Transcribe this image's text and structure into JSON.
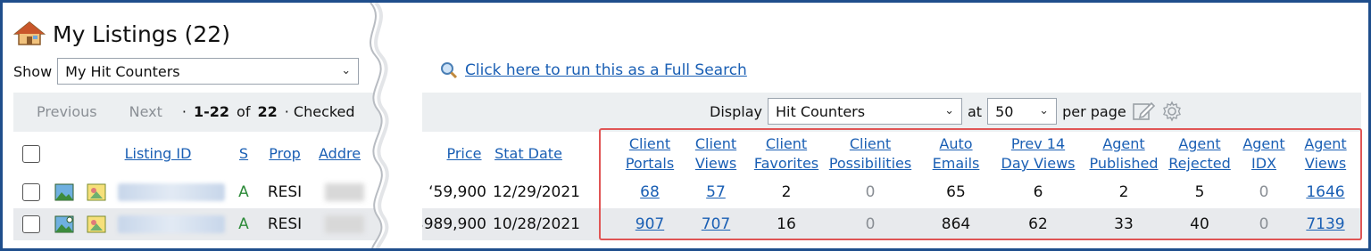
{
  "page": {
    "title": "My Listings (22)",
    "show_label": "Show",
    "show_value": "My Hit Counters",
    "full_search_link": "Click here to run this as a Full Search"
  },
  "toolbar": {
    "previous": "Previous",
    "next": "Next",
    "range_prefix": "·",
    "range": "1-22",
    "of": "of",
    "total": "22",
    "checked": "· Checked",
    "display_label": "Display",
    "display_value": "Hit Counters",
    "at_label": "at",
    "per_page_value": "50",
    "per_page_label": "per page"
  },
  "columns": {
    "listing_id": "Listing ID",
    "s": "S",
    "prop": "Prop",
    "address": "Addre",
    "price": "Price",
    "stat_date": "Stat Date",
    "client_portals": [
      "Client",
      "Portals"
    ],
    "client_views": [
      "Client",
      "Views"
    ],
    "client_favorites": [
      "Client",
      "Favorites"
    ],
    "client_possibilities": [
      "Client",
      "Possibilities"
    ],
    "auto_emails": [
      "Auto",
      "Emails"
    ],
    "prev_14": [
      "Prev 14",
      "Day Views"
    ],
    "agent_published": [
      "Agent",
      "Published"
    ],
    "agent_rejected": [
      "Agent",
      "Rejected"
    ],
    "agent_idx": [
      "Agent",
      "IDX"
    ],
    "agent_views": [
      "Agent",
      "Views"
    ]
  },
  "rows": [
    {
      "status": "A",
      "prop": "RESI",
      "price": "ʻ59,900",
      "stat_date": "12/29/2021",
      "client_portals": "68",
      "client_views": "57",
      "client_favorites": "2",
      "client_possibilities": "0",
      "auto_emails": "65",
      "prev_14": "6",
      "agent_published": "2",
      "agent_rejected": "5",
      "agent_idx": "0",
      "agent_views": "1646"
    },
    {
      "status": "A",
      "prop": "RESI",
      "price": "$989,900",
      "stat_date": "10/28/2021",
      "client_portals": "907",
      "client_views": "707",
      "client_favorites": "16",
      "client_possibilities": "0",
      "auto_emails": "864",
      "prev_14": "62",
      "agent_published": "33",
      "agent_rejected": "40",
      "agent_idx": "0",
      "agent_views": "7139"
    }
  ],
  "icons": {
    "title": "house-icon",
    "search": "magnifier-icon",
    "edit": "edit-icon",
    "settings": "gear-icon",
    "photo": "photo-icon",
    "gallery": "gallery-icon",
    "select_caret": "chevron-down-icon"
  },
  "colors": {
    "frame": "#1f4e8c",
    "link": "#1a5fb4",
    "highlight": "#e05555",
    "status_active": "#2e8b3a"
  }
}
